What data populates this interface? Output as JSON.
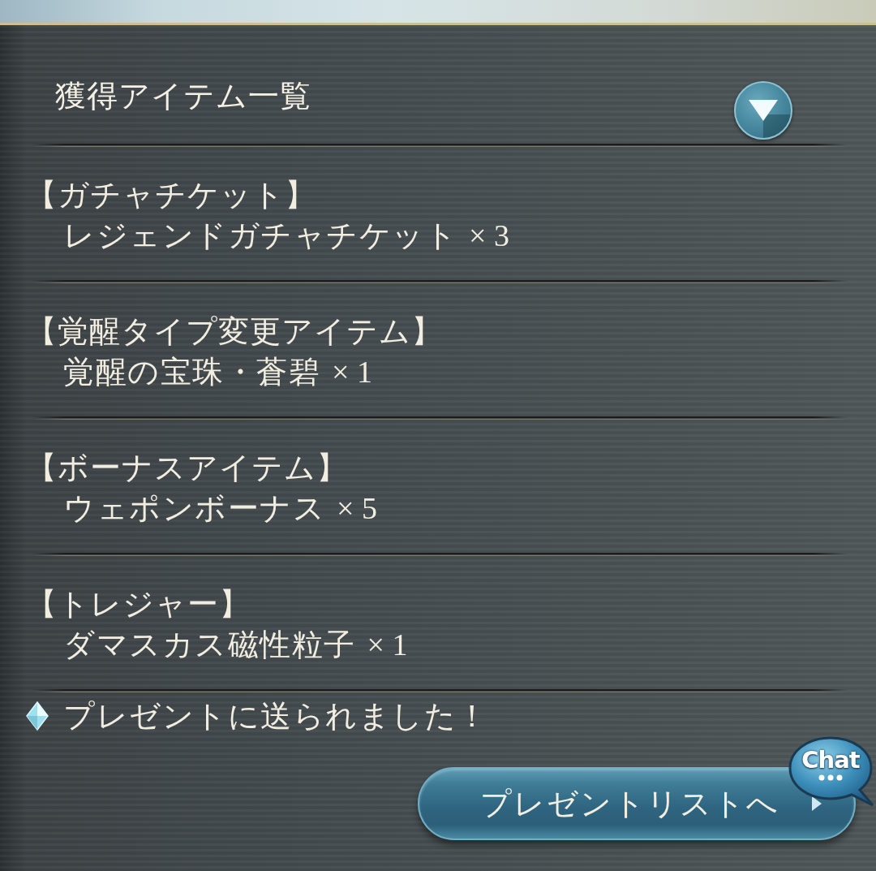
{
  "header": {
    "title": "獲得アイテム一覧"
  },
  "items": [
    {
      "category": "【ガチャチケット】",
      "name": "レジェンドガチャチケット",
      "quantity": "× 3"
    },
    {
      "category": "【覚醒タイプ変更アイテム】",
      "name": "覚醒の宝珠・蒼碧",
      "quantity": "× 1"
    },
    {
      "category": "【ボーナスアイテム】",
      "name": "ウェポンボーナス",
      "quantity": "× 5"
    },
    {
      "category": "【トレジャー】",
      "name": "ダマスカス磁性粒子",
      "quantity": "× 1"
    }
  ],
  "notice": "プレゼントに送られました！",
  "present_list_button": "プレゼントリストへ",
  "chat_button": "Chat"
}
